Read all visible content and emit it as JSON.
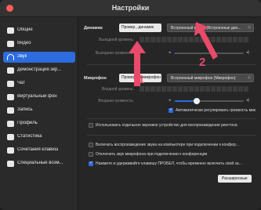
{
  "window": {
    "title": "Настройки"
  },
  "sidebar": {
    "items": [
      {
        "label": "Общие",
        "icon": "gear-icon",
        "active": false
      },
      {
        "label": "Видео",
        "icon": "video-icon",
        "active": false
      },
      {
        "label": "Звук",
        "icon": "headphones-icon",
        "active": true
      },
      {
        "label": "Демонстрация экр...",
        "icon": "screen-share-icon",
        "active": false
      },
      {
        "label": "Чат",
        "icon": "chat-icon",
        "active": false
      },
      {
        "label": "Виртуальный фон",
        "icon": "background-icon",
        "active": false
      },
      {
        "label": "Запись",
        "icon": "record-icon",
        "active": false
      },
      {
        "label": "Профиль",
        "icon": "profile-icon",
        "active": false
      },
      {
        "label": "Статистика",
        "icon": "stats-icon",
        "active": false
      },
      {
        "label": "Сочетания клавиш",
        "icon": "keyboard-icon",
        "active": false
      },
      {
        "label": "Специальные возм...",
        "icon": "accessibility-icon",
        "active": false
      }
    ]
  },
  "speaker": {
    "label": "Динамик",
    "test_label": "Провер...динамик",
    "device": "Встроенный выход (Встроенные дин...",
    "level_label": "Выходной уровень:",
    "volume_label": "Выходная громкость:"
  },
  "microphone": {
    "label": "Микрофон",
    "test_label": "Проверить микрофон",
    "device": "Встроенный микрофон (Микрофон)",
    "level_label": "Входной уровень:",
    "volume_label": "Входная громкость:",
    "auto_adjust": "Автоматически регулировать громкость мик"
  },
  "options": [
    {
      "label": "Использовать отдельное звуковое устройство для воспроизведения рингтона",
      "checked": false
    },
    {
      "label": "Включать воспроизведение звука на компьютере при подключении к конфер...",
      "checked": false
    },
    {
      "label": "Отключить звук микрофона при подключении к конференции",
      "checked": false
    },
    {
      "label": "Нажмите и удерживайте клавишу ПРОБЕЛ, чтобы временно включить свой за...",
      "checked": true
    }
  ],
  "advanced_label": "Расширенные",
  "annotations": {
    "one": "1",
    "two": "2"
  },
  "colors": {
    "accent": "#2d6cdf",
    "arrow": "#e84a6a"
  }
}
